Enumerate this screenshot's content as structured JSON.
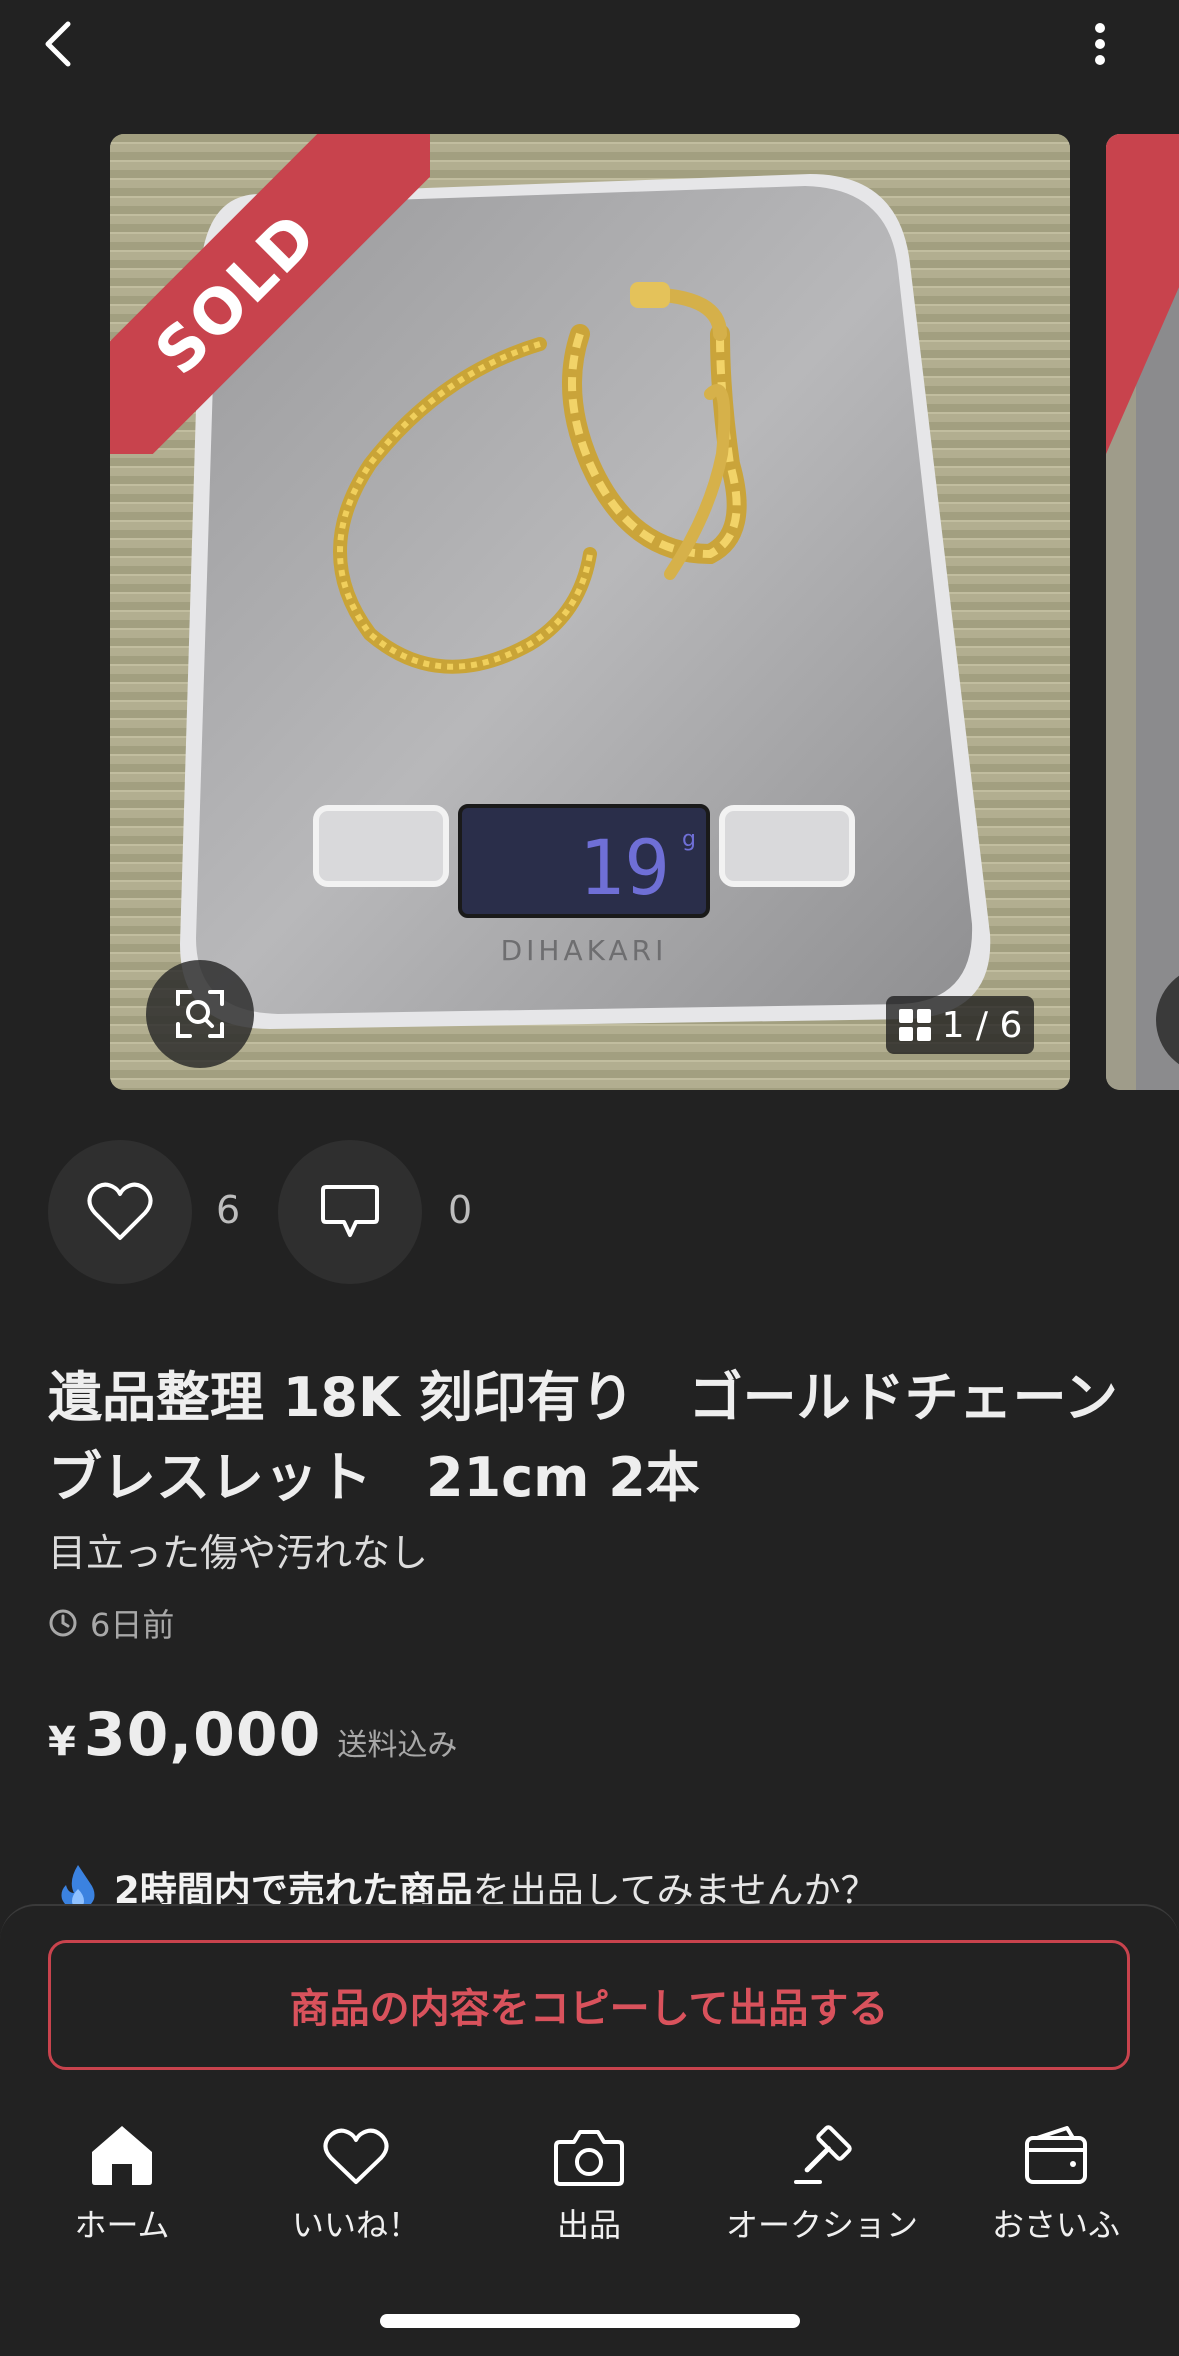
{
  "header": {
    "back_icon": "chevron-left-icon",
    "more_icon": "vertical-ellipsis-icon"
  },
  "gallery": {
    "badge": "SOLD",
    "scale_brand": "DIHAKARI",
    "scale_display": "19",
    "scale_unit": "g",
    "counter": "1 / 6",
    "zoom_icon": "image-search-icon",
    "counter_icon": "grid-icon"
  },
  "social": {
    "likes_count": "6",
    "comments_count": "0",
    "like_icon": "heart-icon",
    "comment_icon": "comment-bubble-icon"
  },
  "item": {
    "title": "遺品整理 18K 刻印有り　ゴールドチェーンブレスレット　21cm 2本",
    "condition": "目立った傷や汚れなし",
    "posted": "6日前",
    "currency": "¥",
    "price": "30,000",
    "shipping": "送料込み"
  },
  "promo": {
    "bold": "2時間内で売れた商品",
    "rest": "を出品してみませんか？",
    "icon": "flame-icon"
  },
  "action": {
    "copy_label": "商品の内容をコピーして出品する"
  },
  "tabs": [
    {
      "label": "ホーム",
      "icon": "home-icon"
    },
    {
      "label": "いいね！",
      "icon": "heart-icon"
    },
    {
      "label": "出品",
      "icon": "camera-icon"
    },
    {
      "label": "オークション",
      "icon": "gavel-icon"
    },
    {
      "label": "おさいふ",
      "icon": "wallet-icon"
    }
  ],
  "colors": {
    "background": "#222222",
    "accent": "#c8434d",
    "sold_badge": "#c8434d",
    "text": "#eeeeee",
    "muted": "#a8a8a8",
    "flame": "#3b82e0"
  }
}
